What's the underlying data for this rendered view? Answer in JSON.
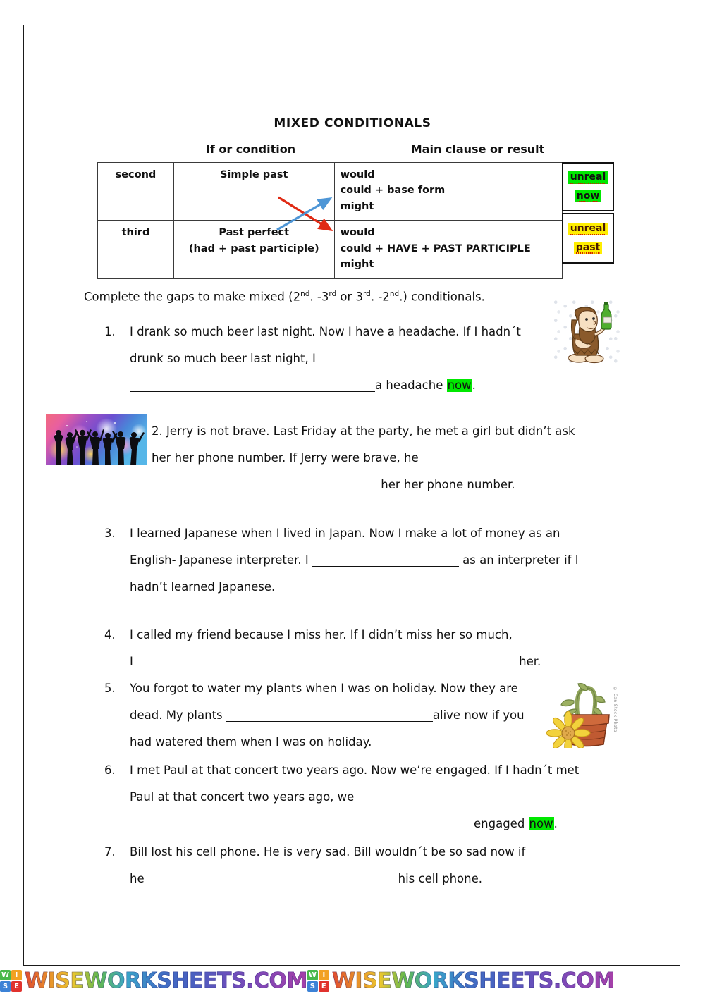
{
  "worksheet": {
    "title": "MIXED CONDITIONALS"
  },
  "table": {
    "caption_if": "If or condition",
    "caption_main": "Main clause or result",
    "rows": [
      {
        "type": "second",
        "condition": "Simple past",
        "result_lines": [
          "would",
          "could + base form",
          "might"
        ],
        "tags": [
          "unreal",
          "now"
        ],
        "tag_color": "#00e800"
      },
      {
        "type": "third",
        "condition_line1": "Past perfect",
        "condition_line2": "(had + past participle)",
        "result_lines": [
          "would",
          "could + HAVE + PAST PARTICIPLE",
          "might"
        ],
        "tags": [
          "unreal",
          "past"
        ],
        "tag_color": "#ffee00"
      }
    ]
  },
  "instruction": {
    "part1": "Complete the gaps to make mixed (2",
    "sup1": "nd",
    "part2": ". -3",
    "sup2": "rd",
    "part3": " or 3",
    "sup3": "rd",
    "part4": ". -2",
    "sup4": "nd",
    "part5": ".) conditionals."
  },
  "exercises": [
    {
      "number": "1.",
      "line1": "I drank so much beer last night. Now I have a headache. If I hadn´t",
      "line2": "drunk so much beer last night, I",
      "line3_after_blank": "a headache ",
      "line3_highlight": "now",
      "line3_end": "."
    },
    {
      "number": "2.",
      "line1": "2. Jerry is not brave. Last Friday at the party, he met a girl but didn’t ask",
      "line2": "her her phone number. If Jerry were brave, he",
      "line3_after_blank": " her her phone number."
    },
    {
      "number": "3.",
      "line1": "I learned Japanese when I lived in Japan. Now I make a lot of money as an",
      "line2_before_blank": "English- Japanese interpreter. I ",
      "line2_after_blank": " as an interpreter if I",
      "line3": "hadn’t learned Japanese."
    },
    {
      "number": "4.",
      "line1": "I called my friend because I miss her. If I didn’t miss her so much,",
      "line2_before_blank": "I",
      "line2_after_blank": " her."
    },
    {
      "number": "5.",
      "line1": "You forgot to water my plants when I was on holiday. Now they are",
      "line2_before_blank": "dead. My plants ",
      "line2_after_blank": "alive now if you",
      "line3": "had watered them when I was on holiday."
    },
    {
      "number": "6.",
      "line1": "I met Paul at that concert two years ago. Now we’re engaged. If I hadn´t met",
      "line2": "Paul at that concert two years ago, we",
      "line3_after_blank": "engaged ",
      "line3_highlight": "now",
      "line3_end": "."
    },
    {
      "number": "7.",
      "line1": "Bill lost his cell phone. He is very sad. Bill wouldn´t be so sad now if",
      "line2_before_blank": "he",
      "line2_after_blank": "his cell phone."
    }
  ],
  "images": {
    "caveman_alt": "caveman holding a beer bottle",
    "party_alt": "party silhouettes dancing",
    "plant_alt": "wilted plant in a terracotta pot",
    "plant_credit": "© Can Stock Photo"
  },
  "footer": {
    "logo_letters": [
      "W",
      "I",
      "S",
      "E"
    ],
    "site_name": "WISEWORKSHEETS.COM"
  }
}
